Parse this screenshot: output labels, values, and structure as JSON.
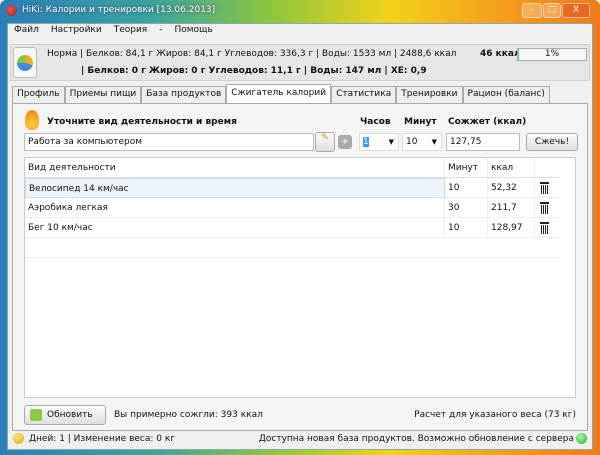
{
  "window": {
    "title": "HiKi: Калории и тренировки [13.06.2013]"
  },
  "menu": [
    "Файл",
    "Настройки",
    "Теория",
    "-",
    "Помощь"
  ],
  "info": {
    "line1": "Норма | Белков: 84,1 г Жиров: 84,1 г Углеводов: 336,3 г | Воды: 1533 мл | 2488,6 ккал",
    "line2": "| Белков: 0 г Жиров: 0 г Углеводов: 11,1 г | Воды: 147 мл | ХЕ: 0,9",
    "kcal": "46 ккал",
    "progress_label": "1%",
    "progress": 1
  },
  "tabs": [
    "Профиль",
    "Приемы пищи",
    "База продуктов",
    "Сжигатель калорий",
    "Статистика",
    "Тренировки",
    "Рацион (баланс)"
  ],
  "active_tab": 3,
  "form": {
    "heading": "Уточните вид деятельности и время",
    "hours_label": "Часов",
    "minutes_label": "Минут",
    "burn_label": "Сожжет (ккал)",
    "activity": "Работа за компьютером",
    "hours": "1",
    "minutes": "10",
    "burn": "127,75",
    "burn_button": "Сжечь!"
  },
  "table": {
    "headers": [
      "Вид деятельности",
      "Минут",
      "ккал"
    ],
    "rows": [
      [
        "Велосипед 14 км/час",
        "10",
        "52,32"
      ],
      [
        "Аэробика легкая",
        "30",
        "211,7"
      ],
      [
        "Бег 10 км/час",
        "10",
        "128,97"
      ]
    ]
  },
  "bottom": {
    "refresh": "Обновить",
    "burned": "Вы примерно сожгли: 393 ккал",
    "weight_note": "Расчет для указаного веса (73 кг)"
  },
  "status": {
    "left": "Дней: 1 | Изменение веса: 0 кг",
    "right": "Доступна новая база продуктов. Возможно обновление с сервера"
  }
}
